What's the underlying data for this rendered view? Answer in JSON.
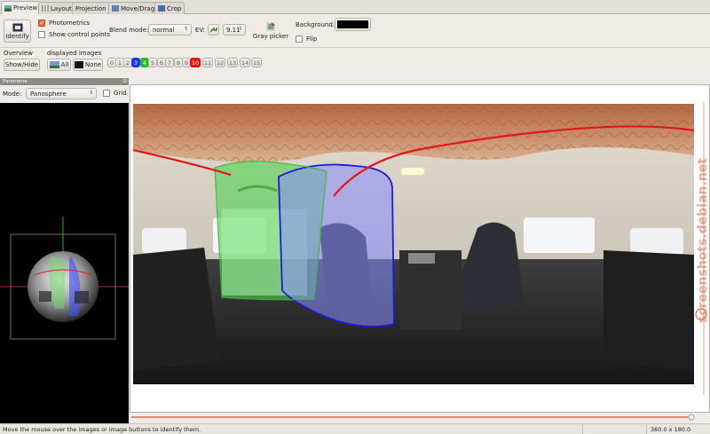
{
  "tabs": [
    {
      "label": "Preview",
      "active": true,
      "icon": "preview-icon"
    },
    {
      "label": "Layout",
      "active": false,
      "icon": "layout-icon"
    },
    {
      "label": "Projection",
      "active": false,
      "icon": null
    },
    {
      "label": "Move/Drag",
      "active": false,
      "icon": "move-drag-icon"
    },
    {
      "label": "Crop",
      "active": false,
      "icon": "crop-icon"
    }
  ],
  "toolbar": {
    "identify_label": "Identify",
    "photometrics_label": "Photometrics",
    "photometrics_checked": true,
    "show_cp_label": "Show control points",
    "show_cp_checked": false,
    "blend_mode_label": "Blend mode:",
    "blend_mode_value": "normal",
    "ev_label": "EV:",
    "ev_value": "9.11",
    "gray_picker_label": "Gray picker",
    "background_label": "Background:",
    "background_color": "#000000",
    "flip_label": "Flip",
    "flip_checked": false
  },
  "overview": {
    "label": "Overview",
    "show_hide_label": "Show/Hide"
  },
  "displayed_images": {
    "label": "displayed images",
    "all_label": "All",
    "none_label": "None",
    "buttons": [
      {
        "label": "0",
        "color": null
      },
      {
        "label": "1",
        "color": null
      },
      {
        "label": "2",
        "color": null
      },
      {
        "label": "3",
        "color": "#1a33ff"
      },
      {
        "label": "4",
        "color": "#22c022"
      },
      {
        "label": "5",
        "color": null
      },
      {
        "label": "6",
        "color": null
      },
      {
        "label": "7",
        "color": null
      },
      {
        "label": "8",
        "color": null
      },
      {
        "label": "9",
        "color": null
      },
      {
        "label": "10",
        "color": "#e81010"
      },
      {
        "label": "11",
        "color": null
      },
      {
        "label": "12",
        "color": null
      },
      {
        "label": "13",
        "color": null
      },
      {
        "label": "14",
        "color": null
      },
      {
        "label": "15",
        "color": null
      }
    ]
  },
  "panorama_panel": {
    "title": "Panorama",
    "mode_label": "Mode:",
    "mode_value": "Panosphere",
    "grid_label": "Grid",
    "grid_checked": false
  },
  "watermark": "screenshots.debian.net",
  "status": {
    "message": "Move the mouse over the images or image buttons to identify them.",
    "fov": "360.0 x 180.0"
  }
}
